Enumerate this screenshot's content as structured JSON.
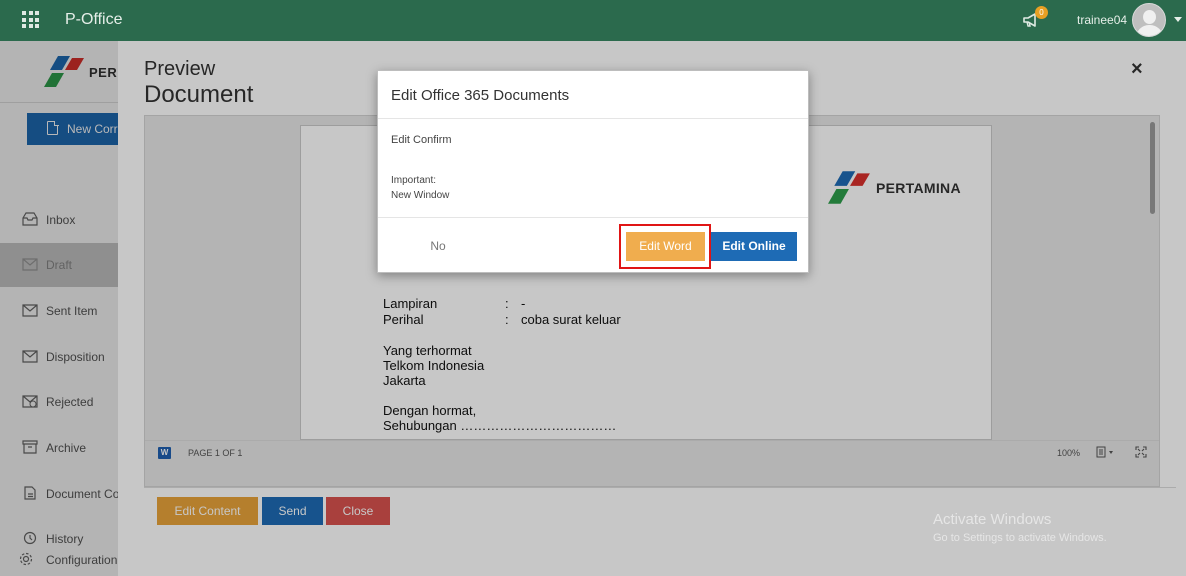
{
  "topbar": {
    "app_title": "P-Office",
    "notification_count": "0",
    "username": "trainee04"
  },
  "sidebar": {
    "logo_text": "PER",
    "new_button_label": "New Corre",
    "items": [
      {
        "label": "Inbox",
        "icon": "inbox-icon"
      },
      {
        "label": "Draft",
        "icon": "draft-icon"
      },
      {
        "label": "Sent Item",
        "icon": "sent-icon"
      },
      {
        "label": "Disposition",
        "icon": "disposition-icon"
      },
      {
        "label": "Rejected",
        "icon": "rejected-icon"
      },
      {
        "label": "Archive",
        "icon": "archive-icon"
      },
      {
        "label": "Document Co",
        "icon": "document-icon"
      },
      {
        "label": "History",
        "icon": "history-icon"
      },
      {
        "label": "Configuration",
        "icon": "gear-icon"
      }
    ],
    "active_item": "Draft"
  },
  "preview": {
    "title_line1": "Preview",
    "title_line2": "Document",
    "close_symbol": "×",
    "document": {
      "logo_text": "PERTAMINA",
      "lines": [
        {
          "label": "Lampiran",
          "sep": ":",
          "value": "-"
        },
        {
          "label": "Perihal",
          "sep": ":",
          "value": "coba surat keluar"
        }
      ],
      "recipient": [
        "Yang terhormat",
        "Telkom Indonesia",
        "Jakarta"
      ],
      "greeting": "Dengan hormat,",
      "body_start": "Sehubungan ………………………………"
    },
    "viewer_footer": {
      "page_indicator": "PAGE 1 OF 1",
      "zoom": "100%"
    },
    "actions": {
      "edit_content": "Edit Content",
      "send": "Send",
      "close": "Close"
    },
    "watermark": {
      "line1": "Activate Windows",
      "line2": "Go to Settings to activate Windows."
    }
  },
  "modal": {
    "title": "Edit Office 365 Documents",
    "confirm_text": "Edit Confirm",
    "important_label": "Important:",
    "important_value": "New Window",
    "no_label": "No",
    "edit_word_label": "Edit Word",
    "edit_online_label": "Edit Online"
  },
  "colors": {
    "topbar": "#2b6a4d",
    "primary": "#1e6bb5",
    "warning": "#f0ad4e",
    "danger": "#d9534f",
    "highlight": "#e01515"
  }
}
